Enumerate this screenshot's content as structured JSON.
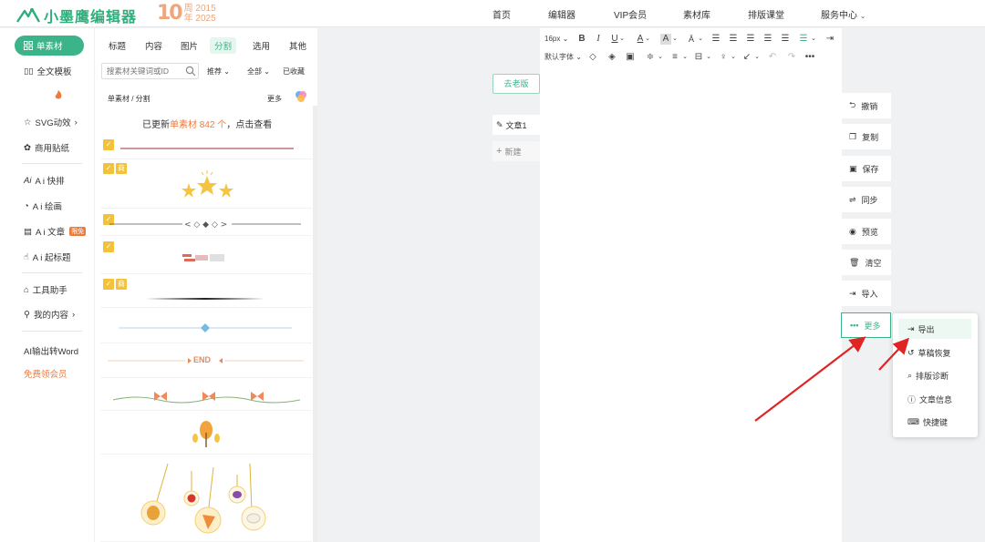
{
  "brand": {
    "name": "小墨鹰编辑器",
    "anniversary_number": "10",
    "anniversary_line1": "周 2015",
    "anniversary_line2": "年 2025",
    "accent": "#3cb48a",
    "orange": "#f07a3c"
  },
  "nav": {
    "items": [
      "首页",
      "编辑器",
      "VIP会员",
      "素材库",
      "排版课堂",
      "服务中心"
    ]
  },
  "sidebar": {
    "active_label": "单素材",
    "items": [
      {
        "label": "全文模板",
        "icon": "grid-icon"
      },
      {
        "label": "SVG动效",
        "icon": "star-icon"
      },
      {
        "label": "商用贴纸",
        "icon": "sticker-icon"
      },
      {
        "label": "A i 快排",
        "icon": "ai-icon"
      },
      {
        "label": "A i 绘画",
        "icon": "palette-icon"
      },
      {
        "label": "A i 文章",
        "icon": "document-icon"
      },
      {
        "label": "A i 起标题",
        "icon": "hand-icon"
      },
      {
        "label": "工具助手",
        "icon": "tools-icon"
      },
      {
        "label": "我的内容",
        "icon": "user-icon"
      }
    ],
    "ai_article_badge": "限免",
    "word_link": "AI输出转Word",
    "free_vip": "免费领会员"
  },
  "panel": {
    "tabs": [
      "标题",
      "内容",
      "图片",
      "分割",
      "选用",
      "其他"
    ],
    "active_tab": "分割",
    "search_placeholder": "搜素材关键词或ID",
    "filters": [
      "推荐 ⌄",
      "全部 ⌄",
      "已收藏"
    ],
    "breadcrumb": "单素材 / 分割",
    "more": "更多",
    "notice_prefix": "已更新",
    "notice_highlight": "单素材 842 个",
    "notice_suffix": "，点击查看",
    "end_label": "END",
    "tag_label": "商"
  },
  "editor": {
    "old_version": "去老版",
    "doc_tab": "文章1",
    "new_doc": "新建",
    "font_size": "16px",
    "default_font": "默认字体"
  },
  "actions": {
    "items": [
      {
        "label": "撤销",
        "icon": "undo-icon"
      },
      {
        "label": "复制",
        "icon": "copy-icon"
      },
      {
        "label": "保存",
        "icon": "save-icon"
      },
      {
        "label": "同步",
        "icon": "sync-icon"
      },
      {
        "label": "预览",
        "icon": "eye-icon"
      },
      {
        "label": "清空",
        "icon": "trash-icon"
      },
      {
        "label": "导入",
        "icon": "import-icon"
      },
      {
        "label": "更多",
        "icon": "more-icon"
      }
    ]
  },
  "more_menu": {
    "items": [
      {
        "label": "导出",
        "icon": "export-icon"
      },
      {
        "label": "草稿恢复",
        "icon": "history-icon"
      },
      {
        "label": "排版诊断",
        "icon": "diagnose-icon"
      },
      {
        "label": "文章信息",
        "icon": "info-icon"
      },
      {
        "label": "快捷键",
        "icon": "keyboard-icon"
      }
    ]
  }
}
